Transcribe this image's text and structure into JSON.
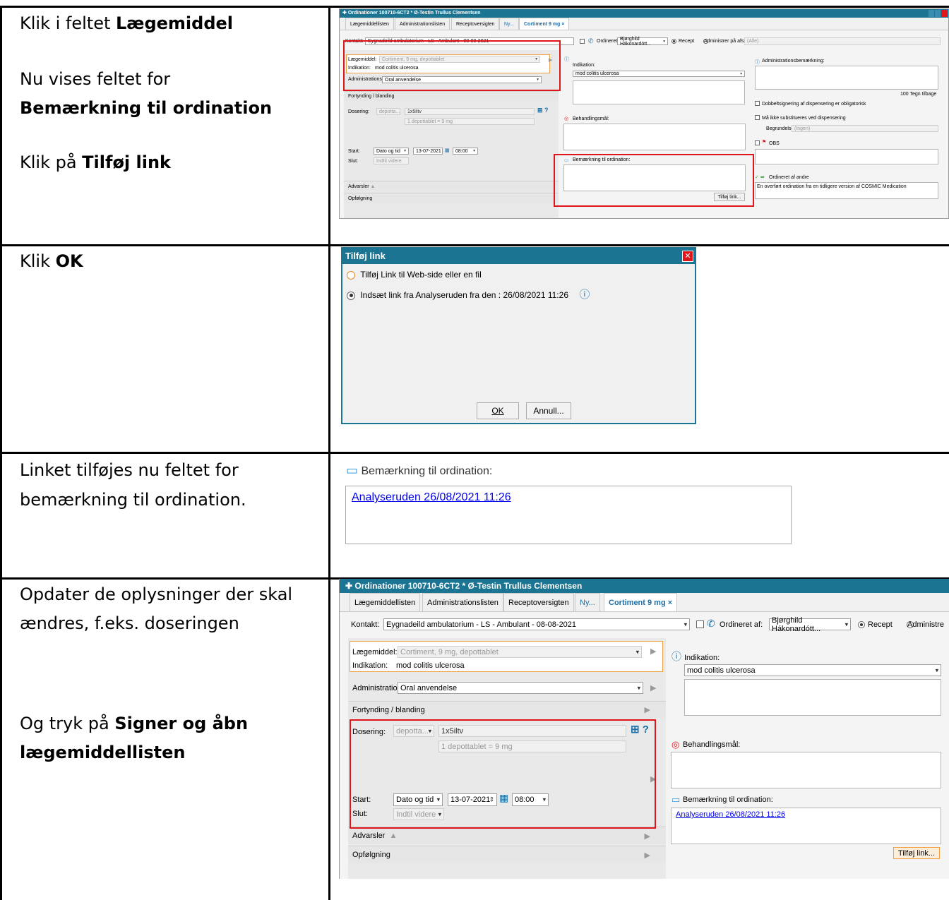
{
  "rows": [
    {
      "lines": [
        {
          "parts": [
            {
              "t": "Klik i feltet "
            },
            {
              "t": "Lægemiddel",
              "b": true
            }
          ]
        },
        {
          "parts": [
            {
              "t": "Nu vises feltet for"
            }
          ]
        },
        {
          "parts": [
            {
              "t": "Bemærkning til ordination",
              "b": true
            }
          ]
        },
        {
          "parts": [
            {
              "t": "Klik på "
            },
            {
              "t": "Tilføj link",
              "b": true
            }
          ]
        }
      ]
    },
    {
      "lines": [
        {
          "parts": [
            {
              "t": "Klik "
            },
            {
              "t": "OK",
              "b": true
            }
          ]
        }
      ]
    },
    {
      "lines": [
        {
          "parts": [
            {
              "t": "Linket tilføjes nu feltet for"
            }
          ]
        },
        {
          "parts": [
            {
              "t": "bemærkning til ordination."
            }
          ]
        }
      ]
    },
    {
      "lines": [
        {
          "parts": [
            {
              "t": "Opdater de oplysninger der skal"
            }
          ]
        },
        {
          "parts": [
            {
              "t": "ændres, f.eks. doseringen"
            }
          ]
        },
        {
          "parts": [
            {
              "t": "Og tryk på "
            },
            {
              "t": "Signer og åbn",
              "b": true
            }
          ]
        },
        {
          "parts": [
            {
              "t": "lægemiddellisten",
              "b": true
            }
          ]
        }
      ]
    }
  ],
  "app": {
    "title": "Ordinationer 100710-6CT2 * Ø-Testin Trullus Clementsen",
    "tabs": [
      "Lægemiddellisten",
      "Administrationslisten",
      "Receptoversigten",
      "Ny...",
      "Cortiment 9 mg"
    ],
    "kontakt_label": "Kontakt:",
    "kontakt_value": "Eygnadeild ambulatorium - LS - Ambulant - 08-08-2021",
    "ordineret_label": "Ordineret af:",
    "ordineret_value": "Bjørghild Hákonardótt...",
    "recept": "Recept",
    "administrer": "Administrer på afsnit:",
    "administrer_short": "Administre",
    "alle": "(Alle)",
    "laegemiddel_label": "Lægemiddel:",
    "laegemiddel_value": "Cortiment, 9 mg, depottablet",
    "indikation_label": "Indikation:",
    "indikation_value": "mod colitis ulcerosa",
    "adminvej_label": "Administrationsvej",
    "adminvej_value": "Oral anvendelse",
    "fortynding": "Fortynding / blanding",
    "dosering_label": "Dosering:",
    "dosering_type": "depotta...",
    "dosering_value": "1x5iltv",
    "dosering_calc": "1 depottablet = 9 mg",
    "start_label": "Start:",
    "start_mode": "Dato og tid",
    "start_date": "13-07-2021",
    "start_time": "08:00",
    "slut_label": "Slut:",
    "slut_value": "Indtil videre",
    "advarsler": "Advarsler",
    "opfolgning": "Opfølgning",
    "indikation_head": "Indikation:",
    "behandlingsmaal": "Behandlingsmål:",
    "bemaerkning": "Bemærkning til ordination:",
    "tilfoj_link": "Tilføj link...",
    "admin_bem": "Administrationsbemærkning:",
    "tegn_tilbage": "100 Tegn tilbage",
    "dobbelt": "Dobbeltsignering af dispensering er obligatorisk",
    "maa_ikke": "Må ikke substitueres ved dispensering",
    "begrundelse_label": "Begrundelse:",
    "begrundelse_value": "(Ingen)",
    "obs": "OBS",
    "ordineret_andre": "Ordineret af andre",
    "overfort": "En overført ordination fra en tidligere version af COSMIC Medication",
    "link_text": "Analyseruden 26/08/2021 11:26"
  },
  "dialog": {
    "title": "Tilføj link",
    "option1": "Tilføj Link til Web-side eller en fil",
    "option2": "Indsæt link fra Analyseruden fra den :  26/08/2021 11:26",
    "ok": "OK",
    "cancel": "Annull..."
  },
  "snippet": {
    "label": "Bemærkning til ordination:",
    "link": "Analyseruden 26/08/2021 11:26"
  }
}
